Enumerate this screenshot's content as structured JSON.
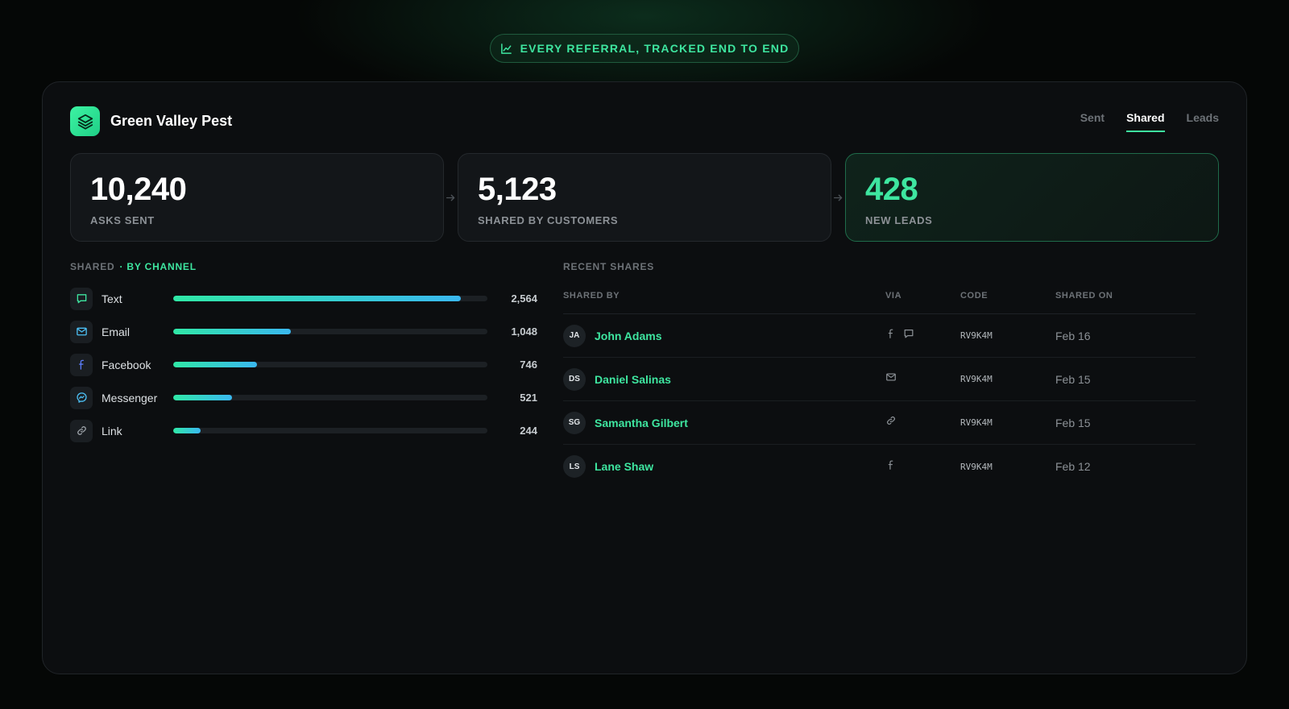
{
  "banner": {
    "text": "EVERY REFERRAL, TRACKED END TO END",
    "icon": "chart-line-icon"
  },
  "brand": {
    "name": "Green Valley Pest",
    "icon": "layers-icon",
    "accent": "#3ee6a0"
  },
  "tabs": [
    {
      "label": "Sent",
      "active": false
    },
    {
      "label": "Shared",
      "active": true
    },
    {
      "label": "Leads",
      "active": false
    }
  ],
  "stats": [
    {
      "value": "10,240",
      "label": "ASKS SENT"
    },
    {
      "value": "5,123",
      "label": "SHARED BY CUSTOMERS"
    },
    {
      "value": "428",
      "label": "NEW LEADS"
    }
  ],
  "channels": {
    "title": "SHARED",
    "subtitle": "· BY CHANNEL",
    "max": 2800,
    "items": [
      {
        "label": "Text",
        "count": "2,564",
        "value": 2564,
        "icon": "message-icon"
      },
      {
        "label": "Email",
        "count": "1,048",
        "value": 1048,
        "icon": "mail-icon"
      },
      {
        "label": "Facebook",
        "count": "746",
        "value": 746,
        "icon": "facebook-icon"
      },
      {
        "label": "Messenger",
        "count": "521",
        "value": 521,
        "icon": "messenger-icon"
      },
      {
        "label": "Link",
        "count": "244",
        "value": 244,
        "icon": "link-icon"
      }
    ]
  },
  "recent": {
    "title": "RECENT SHARES",
    "columns": [
      "SHARED BY",
      "VIA",
      "CODE",
      "SHARED ON"
    ],
    "rows": [
      {
        "initials": "JA",
        "name": "John Adams",
        "via": [
          "facebook-icon",
          "message-icon"
        ],
        "code": "RV9K4M",
        "date": "Feb 16"
      },
      {
        "initials": "DS",
        "name": "Daniel Salinas",
        "via": [
          "mail-icon"
        ],
        "code": "RV9K4M",
        "date": "Feb 15"
      },
      {
        "initials": "SG",
        "name": "Samantha Gilbert",
        "via": [
          "link-icon"
        ],
        "code": "RV9K4M",
        "date": "Feb 15"
      },
      {
        "initials": "LS",
        "name": "Lane Shaw",
        "via": [
          "facebook-icon"
        ],
        "code": "RV9K4M",
        "date": "Feb 12"
      }
    ]
  }
}
